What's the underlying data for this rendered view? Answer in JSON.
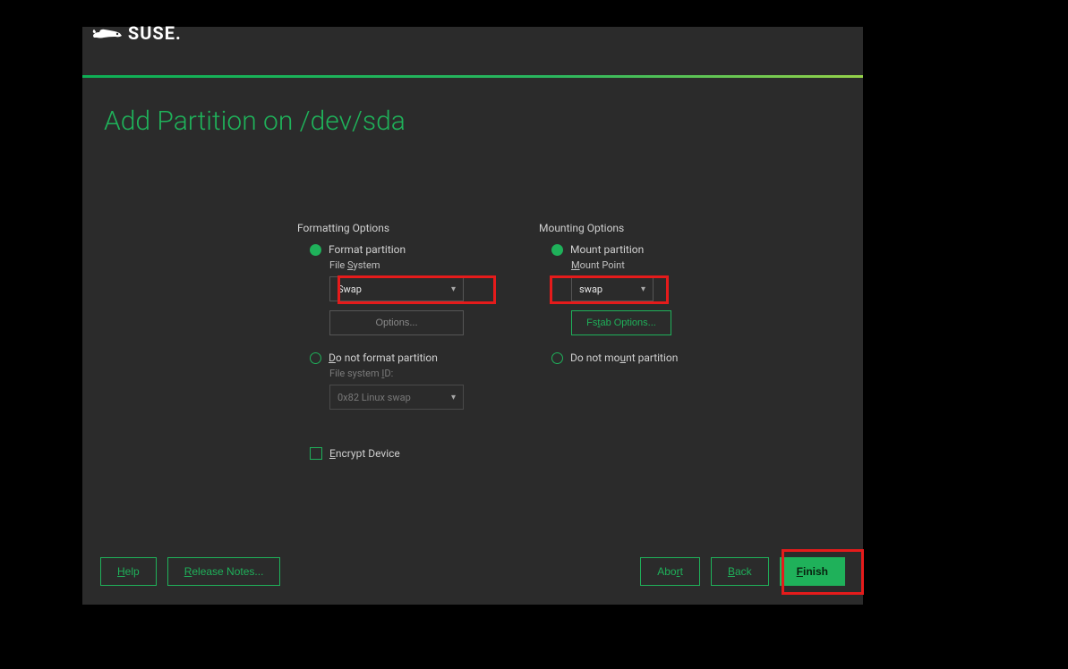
{
  "brand": "SUSE",
  "title": "Add Partition on /dev/sda",
  "formatting": {
    "heading": "Formatting Options",
    "format_label": "Format partition",
    "fs_label_pre": "File ",
    "fs_label_u": "S",
    "fs_label_post": "ystem",
    "fs_value": "Swap",
    "options_btn": "Options...",
    "noformat_pre": "",
    "noformat_u": "D",
    "noformat_post": "o not format partition",
    "fsid_pre": "File system ",
    "fsid_u": "I",
    "fsid_post": "D:",
    "fsid_value": "0x82 Linux swap",
    "encrypt_u": "E",
    "encrypt_post": "ncrypt Device"
  },
  "mounting": {
    "heading": "Mounting Options",
    "mount_label": "Mount partition",
    "mp_u": "M",
    "mp_post": "ount Point",
    "mp_value": "swap",
    "fstab_pre": "Fs",
    "fstab_u": "t",
    "fstab_post": "ab Options...",
    "nomount_pre": "Do not mo",
    "nomount_u": "u",
    "nomount_post": "nt partition"
  },
  "footer": {
    "help_u": "H",
    "help_post": "elp",
    "release_u": "R",
    "release_post": "elease Notes...",
    "abort_pre": "Abo",
    "abort_u": "r",
    "abort_post": "t",
    "back_u": "B",
    "back_post": "ack",
    "finish_u": "F",
    "finish_post": "inish"
  }
}
